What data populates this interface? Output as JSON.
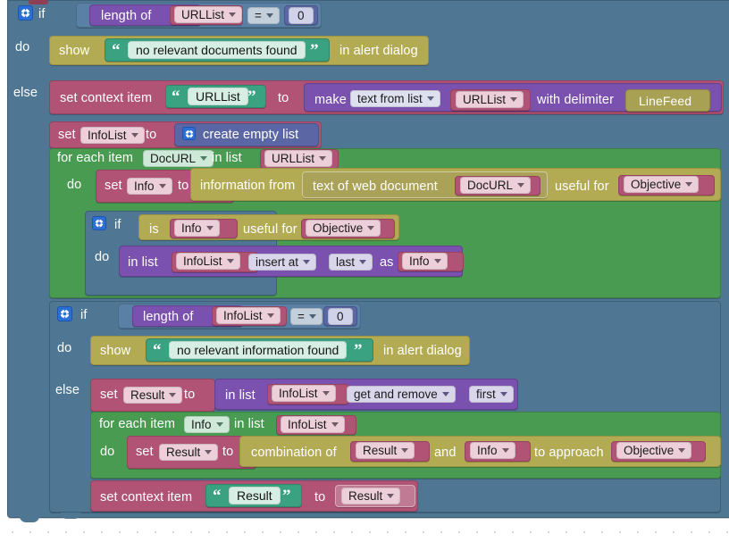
{
  "workspace": {
    "title": "Blockly visual program editor",
    "background": "#ffffff",
    "grid_dot_color": "#c8c8c8"
  },
  "palette": {
    "control": "#4f7794",
    "text": "#3aa181",
    "olive": "#b3ab53",
    "variable": "#b15374",
    "list": "#7a51ae",
    "math": "#5b67a5",
    "loop": "#4a9b52",
    "logic": "#5b80a5"
  },
  "labels": {
    "if": "if",
    "do": "do",
    "else": "else",
    "show": "show",
    "in_alert_dialog": "in alert dialog",
    "length_of": "length of",
    "equals": "=",
    "zero": "0",
    "set_context_item": "set context item",
    "to": "to",
    "make": "make",
    "text_from_list": "text from list",
    "with_delimiter": "with delimiter",
    "linefeed": "LineFeed",
    "set": "set",
    "create_empty_list": "create empty list",
    "for_each_item": "for each item",
    "in_list": "in list",
    "information_from": "information from",
    "text_of_web_document": "text of web document",
    "useful_for": "useful for",
    "is": "is",
    "in_list_op": "in list",
    "insert_at": "insert at",
    "last": "last",
    "as": "as",
    "get_and_remove": "get and remove",
    "first": "first",
    "combination_of": "combination of",
    "and": "and",
    "to_approach": "to approach"
  },
  "variables": {
    "urllist": "URLList",
    "infolist": "InfoList",
    "docurl": "DocURL",
    "info": "Info",
    "objective": "Objective",
    "result": "Result"
  },
  "strings": {
    "no_relevant_documents_found": "no relevant documents found",
    "no_relevant_information_found": "no relevant information found",
    "urllist_literal": "URLList",
    "result_literal": "Result"
  },
  "icons": {
    "mutator": "gear-icon",
    "dropdown": "chevron-down-icon"
  }
}
